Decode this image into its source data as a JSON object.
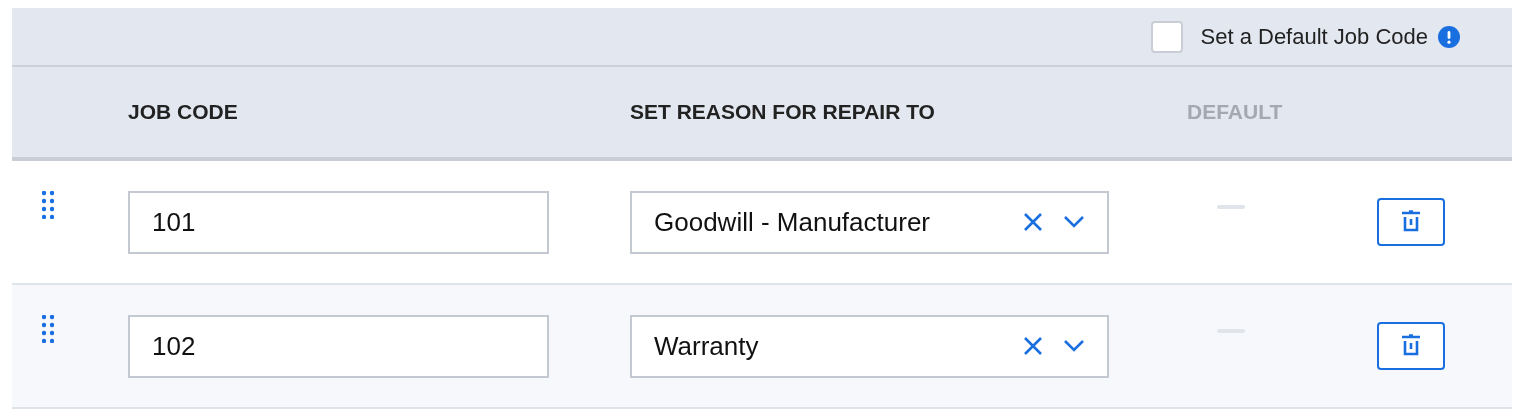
{
  "default_toggle": {
    "label": "Set a Default Job Code",
    "checked": false
  },
  "columns": [
    "JOB CODE",
    "SET REASON FOR REPAIR TO",
    "DEFAULT"
  ],
  "rows": [
    {
      "job_code": "101",
      "reason": "Goodwill - Manufacturer"
    },
    {
      "job_code": "102",
      "reason": "Warranty"
    }
  ]
}
